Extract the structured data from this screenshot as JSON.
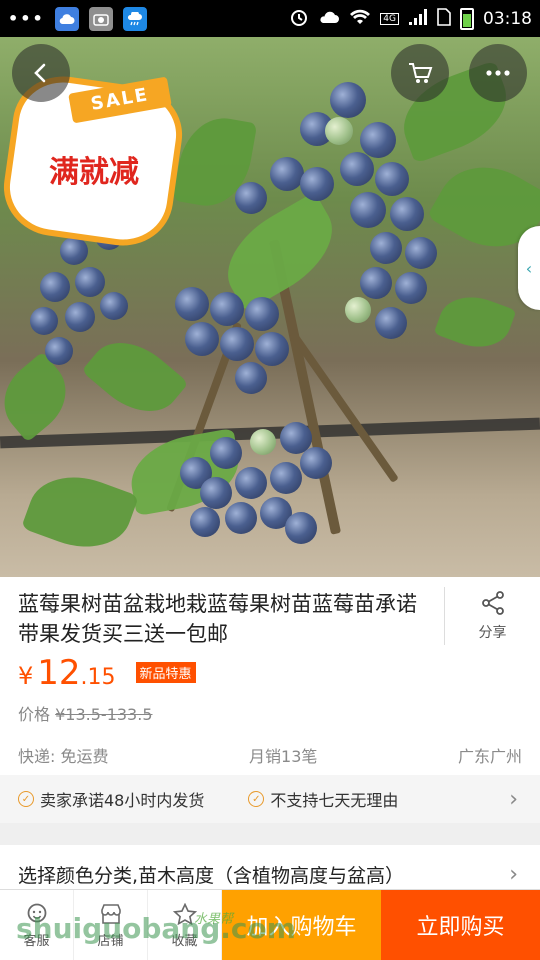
{
  "status_bar": {
    "time": "03:18",
    "network": "4G",
    "left_icons": [
      "cloud-app-icon",
      "screenshot-icon",
      "weather-app-icon"
    ],
    "right_icons": [
      "alarm-icon",
      "weather-icon",
      "wifi-icon",
      "signal-icon",
      "sim-icon",
      "battery-icon"
    ]
  },
  "hero": {
    "badge_ribbon": "SALE",
    "badge_text": "满就减",
    "dots_count": 5,
    "active_dot": 0
  },
  "product": {
    "title": "蓝莓果树苗盆栽地栽蓝莓果树苗蓝莓苗承诺带果发货买三送一包邮",
    "share_label": "分享",
    "price_symbol": "¥",
    "price_int": "12",
    "price_dec": ".15",
    "new_badge": "新品特惠",
    "orig_label": "价格",
    "orig_price": "¥13.5-133.5",
    "shipping": "快递: 免运费",
    "monthly_sales": "月销13笔",
    "location": "广东广州"
  },
  "promises": [
    "卖家承诺48小时内发货",
    "不支持七天无理由"
  ],
  "sku": {
    "label": "选择颜色分类,苗木高度（含植物高度与盆高）"
  },
  "bottom_bar": {
    "service": "客服",
    "shop": "店铺",
    "favorite": "收藏",
    "add_cart": "加入购物车",
    "buy_now": "立即购买"
  },
  "watermark": {
    "text": "shuiguobang.com",
    "cn": "水果帮"
  },
  "colors": {
    "accent": "#ff5000",
    "cart": "#ffa100",
    "promise_check": "#e89a2c"
  }
}
